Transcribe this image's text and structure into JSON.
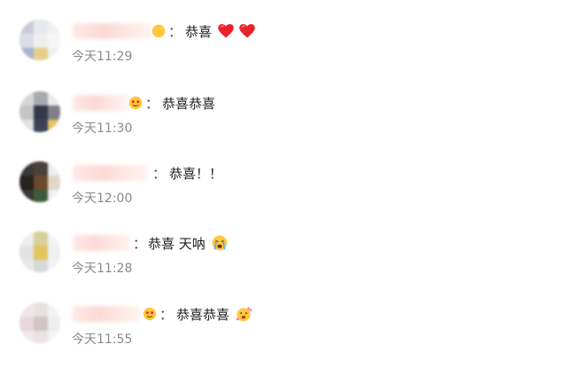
{
  "comments": [
    {
      "text": "恭喜",
      "emojis": [
        "heart-icon",
        "heart-icon"
      ],
      "time": "今天11:29"
    },
    {
      "text": "恭喜恭喜",
      "emojis": [],
      "time": "今天11:30"
    },
    {
      "text": "恭喜！！",
      "emojis": [],
      "time": "今天12:00"
    },
    {
      "text": "恭喜 天呐",
      "emojis": [
        "crying-face-icon"
      ],
      "time": "今天11:28"
    },
    {
      "text": "恭喜恭喜",
      "emojis": [
        "flower-face-icon"
      ],
      "time": "今天11:55"
    }
  ],
  "colon": "：",
  "colors": {
    "heart": "#e8232c",
    "emoji_yellow": "#ffc83d",
    "time_text": "#8a8a8a",
    "body_text": "#222222"
  }
}
